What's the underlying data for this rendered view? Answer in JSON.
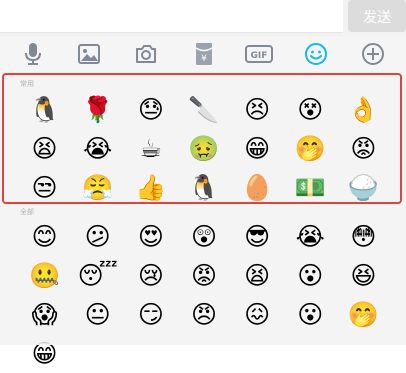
{
  "composer": {
    "input_value": "",
    "send_label": "发送"
  },
  "toolbar": {
    "icons": [
      "microphone-icon",
      "image-icon",
      "camera-icon",
      "red-packet-icon",
      "gif-icon",
      "emoji-icon",
      "plus-icon"
    ],
    "active_icon": "emoji-icon",
    "red_packet_glyph": "¥",
    "gif_label": "GIF",
    "colors": {
      "icon": "#7f8a96",
      "active": "#12b7f5",
      "red_packet": "#9aa3ad"
    }
  },
  "emoji_panel": {
    "recent": {
      "label": "常用",
      "items": [
        "🐧",
        "🌹",
        "😓",
        "🔪",
        "😣",
        "😵",
        "👌",
        "😫",
        "😭",
        "☕",
        "🤢",
        "😁",
        "🤭",
        "😡",
        "😒",
        "😤",
        "👍",
        "🐧",
        "🥚",
        "💵",
        "🍚"
      ]
    },
    "all": {
      "label": "全部",
      "items": [
        "😊",
        "😕",
        "😍",
        "😲",
        "😎",
        "😭",
        "😳",
        "🤐",
        "😴",
        "😢",
        "😡",
        "😫",
        "😮",
        "😆",
        "😱",
        "😐",
        "😏",
        "😠",
        "😖",
        "😮",
        "🤭",
        "😁"
      ]
    },
    "highlight_color": "#e0443c"
  }
}
